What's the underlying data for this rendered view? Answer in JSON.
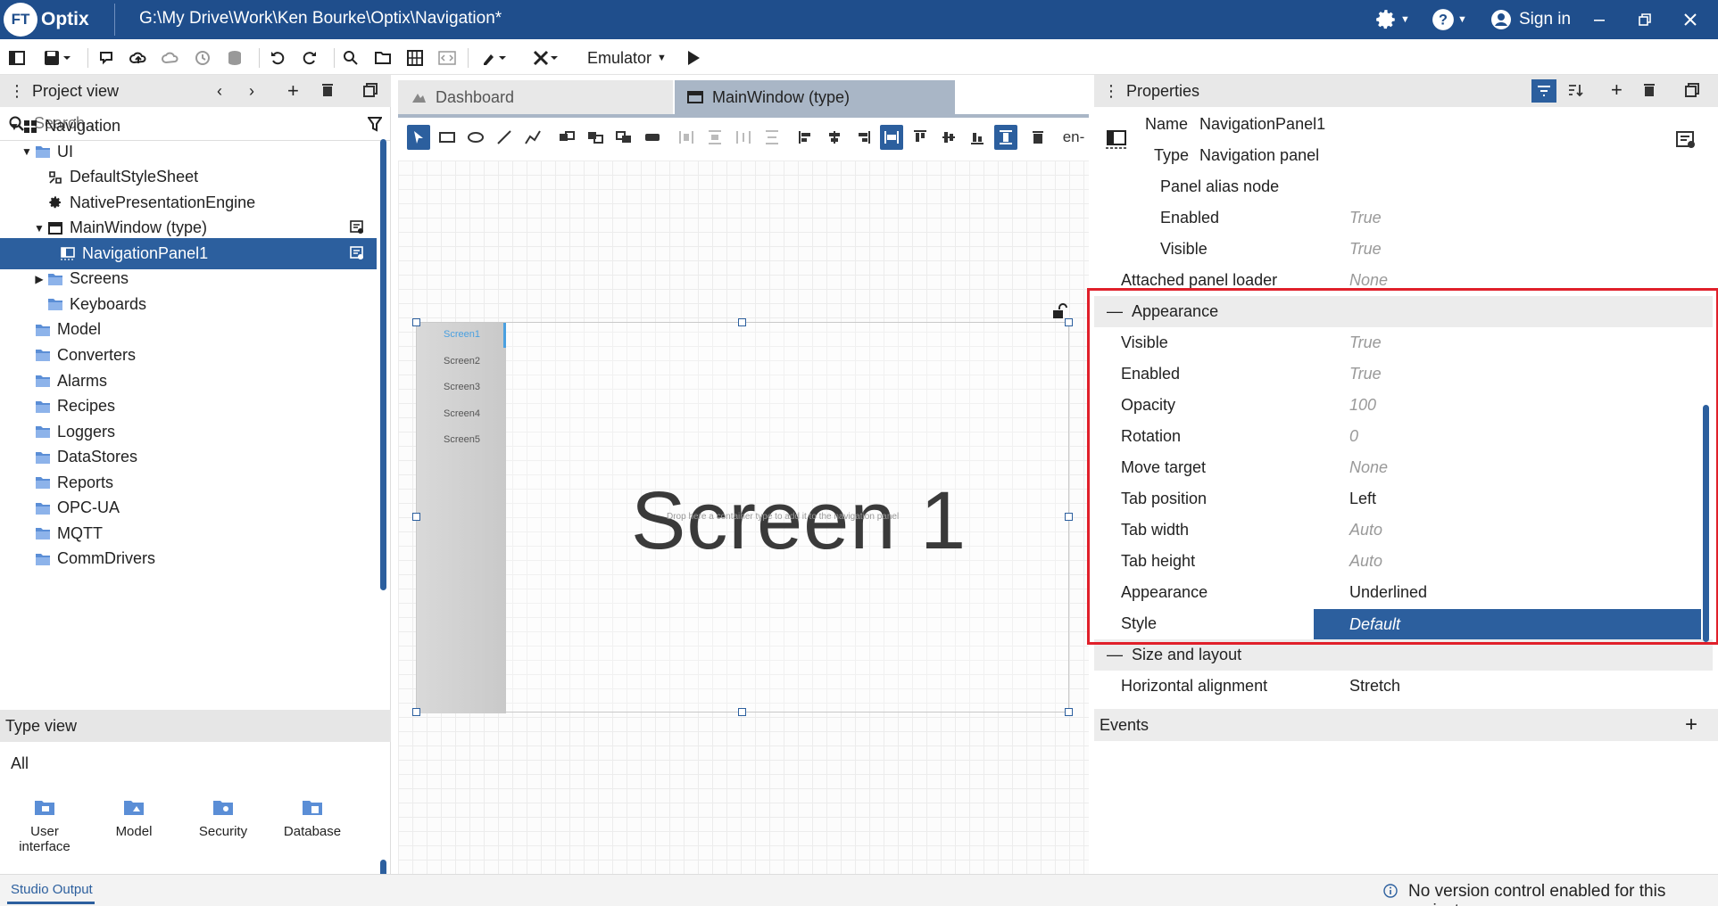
{
  "app": {
    "logo_ft": "FT",
    "logo_name": "Optix",
    "window_title": "G:\\My Drive\\Work\\Ken Bourke\\Optix\\Navigation*",
    "sign_in": "Sign in"
  },
  "toolbar": {
    "emulator_label": "Emulator"
  },
  "project_view": {
    "title": "Project view",
    "search_placeholder": "Search...",
    "tree": [
      {
        "label": "Navigation",
        "icon": "grid-icon"
      },
      {
        "label": "UI",
        "icon": "folder-icon"
      },
      {
        "label": "DefaultStyleSheet",
        "icon": "stylesheet-icon"
      },
      {
        "label": "NativePresentationEngine",
        "icon": "gear-icon"
      },
      {
        "label": "MainWindow (type)",
        "icon": "window-icon"
      },
      {
        "label": "NavigationPanel1",
        "icon": "navigation-panel-icon"
      },
      {
        "label": "Screens",
        "icon": "folder-icon"
      },
      {
        "label": "Keyboards",
        "icon": "folder-icon"
      },
      {
        "label": "Model",
        "icon": "folder-icon"
      },
      {
        "label": "Converters",
        "icon": "folder-icon"
      },
      {
        "label": "Alarms",
        "icon": "folder-icon"
      },
      {
        "label": "Recipes",
        "icon": "folder-icon"
      },
      {
        "label": "Loggers",
        "icon": "folder-icon"
      },
      {
        "label": "DataStores",
        "icon": "folder-icon"
      },
      {
        "label": "Reports",
        "icon": "folder-icon"
      },
      {
        "label": "OPC-UA",
        "icon": "folder-icon"
      },
      {
        "label": "MQTT",
        "icon": "folder-icon"
      },
      {
        "label": "CommDrivers",
        "icon": "folder-icon"
      }
    ]
  },
  "type_view": {
    "title": "Type view",
    "filter": "All",
    "items": [
      {
        "label": "User interface"
      },
      {
        "label": "Model"
      },
      {
        "label": "Security"
      },
      {
        "label": "Database"
      }
    ]
  },
  "editor": {
    "tabs": [
      {
        "label": "Dashboard"
      },
      {
        "label": "MainWindow (type)"
      }
    ],
    "locale": "en-",
    "nav_tabs": [
      "Screen1",
      "Screen2",
      "Screen3",
      "Screen4",
      "Screen5"
    ],
    "screen_title": "Screen 1",
    "drop_hint": "Drop here a container type to add it to the navigation panel"
  },
  "properties": {
    "title": "Properties",
    "name_label": "Name",
    "name_value": "NavigationPanel1",
    "type_label": "Type",
    "type_value": "Navigation panel",
    "rows_top": [
      {
        "label": "Panel alias node",
        "value": ""
      },
      {
        "label": "Enabled",
        "value": "True"
      },
      {
        "label": "Visible",
        "value": "True"
      },
      {
        "label": "Attached panel loader",
        "value": "None"
      }
    ],
    "appearance_section": "Appearance",
    "appearance_rows": [
      {
        "label": "Visible",
        "value": "True"
      },
      {
        "label": "Enabled",
        "value": "True"
      },
      {
        "label": "Opacity",
        "value": "100"
      },
      {
        "label": "Rotation",
        "value": "0"
      },
      {
        "label": "Move target",
        "value": "None"
      },
      {
        "label": "Tab position",
        "value": "Left"
      },
      {
        "label": "Tab width",
        "value": "Auto"
      },
      {
        "label": "Tab height",
        "value": "Auto"
      },
      {
        "label": "Appearance",
        "value": "Underlined"
      },
      {
        "label": "Style",
        "value": "Default"
      }
    ],
    "size_section": "Size and layout",
    "size_rows": [
      {
        "label": "Horizontal alignment",
        "value": "Stretch"
      }
    ],
    "events_title": "Events"
  },
  "status": {
    "studio_output": "Studio Output",
    "version_control": "No version control enabled for this project."
  },
  "colors": {
    "accent": "#2c5f9e",
    "titlebar": "#1f4e8c",
    "highlight": "#e0202a"
  }
}
